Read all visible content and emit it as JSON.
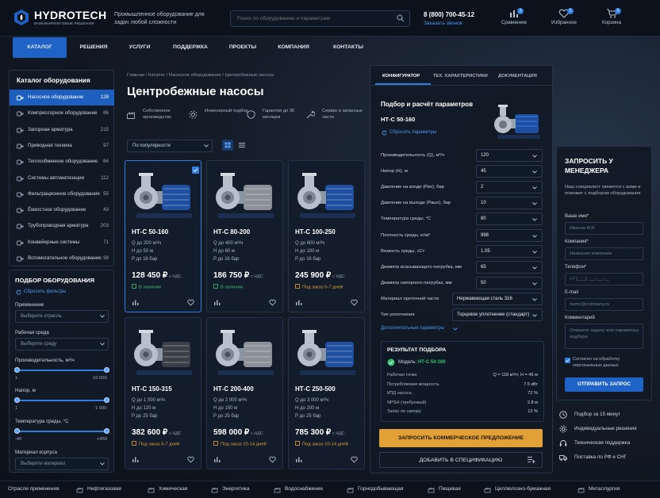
{
  "header": {
    "logo_name": "HYDROTECH",
    "logo_sub": "ИНЖИНИРИНГОВЫЕ РЕШЕНИЯ",
    "tagline": "Промышленное оборудование для задач любой сложности",
    "search_placeholder": "Поиск по оборудованию и параметрам",
    "phone": "8 (800) 700-45-12",
    "callback": "Заказать звонок",
    "actions": [
      {
        "label": "Сравнение",
        "count": "3"
      },
      {
        "label": "Избранное",
        "count": "2"
      },
      {
        "label": "Корзина",
        "count": "0"
      }
    ]
  },
  "nav": [
    "КАТАЛОГ",
    "РЕШЕНИЯ",
    "УСЛУГИ",
    "ПОДДЕРЖКА",
    "ПРОЕКТЫ",
    "КОМПАНИЯ",
    "КОНТАКТЫ"
  ],
  "catalog": {
    "title": "Каталог оборудования",
    "items": [
      {
        "name": "Насосное оборудование",
        "count": "128"
      },
      {
        "name": "Компрессорное оборудование",
        "count": "86"
      },
      {
        "name": "Запорная арматура",
        "count": "215"
      },
      {
        "name": "Приводная техника",
        "count": "97"
      },
      {
        "name": "Теплообменное оборудование",
        "count": "64"
      },
      {
        "name": "Системы автоматизации",
        "count": "112"
      },
      {
        "name": "Фильтрационное оборудование",
        "count": "55"
      },
      {
        "name": "Ёмкостное оборудование",
        "count": "43"
      },
      {
        "name": "Трубопроводная арматура",
        "count": "203"
      },
      {
        "name": "Конвейерные системы",
        "count": "71"
      },
      {
        "name": "Вспомогательное оборудование",
        "count": "98"
      }
    ]
  },
  "filters": {
    "title": "ПОДБОР ОБОРУДОВАНИЯ",
    "reset": "Сбросить фильтры",
    "application_label": "Применение",
    "application_placeholder": "Выберите отрасль",
    "medium_label": "Рабочая среда",
    "medium_placeholder": "Выберите среду",
    "flow_label": "Производительность, м³/ч",
    "flow_min": "1",
    "flow_max": "10 000",
    "head_label": "Напор, м",
    "head_min": "1",
    "head_max": "1 000",
    "temp_label": "Температура среды, °С",
    "temp_min": "-40",
    "temp_max": "+450",
    "material_label": "Материал корпуса",
    "material_placeholder": "Выберите материал"
  },
  "main": {
    "breadcrumb": "Главная  /  Каталог  /  Насосное оборудование  /  Центробежные насосы",
    "title": "Центробежные насосы",
    "features": [
      "Собственное производство",
      "Инженерный подбор",
      "Гарантия до 36 месяцев",
      "Сервис и запасные части"
    ],
    "sort": "По популярности"
  },
  "products": [
    {
      "name": "НТ-С 50-160",
      "q": "Q до 200 м³/ч",
      "h": "Н до 50 м",
      "p": "P до 16 бар",
      "price": "128 450 ₽",
      "vat": "с НДС",
      "stock": "В наличии",
      "stock_color": "#39c172",
      "selected": true,
      "motor": "#1f4fa0"
    },
    {
      "name": "НТ-С 80-200",
      "q": "Q до 400 м³/ч",
      "h": "Н до 80 м",
      "p": "P до 16 бар",
      "price": "186 750 ₽",
      "vat": "с НДС",
      "stock": "В наличии",
      "stock_color": "#39c172",
      "selected": false,
      "motor": "#8b9099"
    },
    {
      "name": "НТ-С 100-250",
      "q": "Q до 600 м³/ч",
      "h": "Н до 100 м",
      "p": "P до 16 бар",
      "price": "245 900 ₽",
      "vat": "с НДС",
      "stock": "Под заказ 5-7 дней",
      "stock_color": "#e2a136",
      "selected": false,
      "motor": "#1f4fa0"
    },
    {
      "name": "НТ-С 150-315",
      "q": "Q до 1 000 м³/ч",
      "h": "Н до 120 м",
      "p": "P до 25 бар",
      "price": "382 600 ₽",
      "vat": "с НДС",
      "stock": "Под заказ 5-7 дней",
      "stock_color": "#e2a136",
      "selected": false,
      "motor": "#3a3f47"
    },
    {
      "name": "НТ-С 200-400",
      "q": "Q до 2 000 м³/ч",
      "h": "Н до 150 м",
      "p": "P до 25 бар",
      "price": "598 000 ₽",
      "vat": "с НДС",
      "stock": "Под заказ 10-14 дней",
      "stock_color": "#e2a136",
      "selected": false,
      "motor": "#8b9099"
    },
    {
      "name": "НТ-С 250-500",
      "q": "Q до 3 000 м³/ч",
      "h": "Н до 200 м",
      "p": "P до 25 бар",
      "price": "785 300 ₽",
      "vat": "с НДС",
      "stock": "Под заказ 10-14 дней",
      "stock_color": "#e2a136",
      "selected": false,
      "motor": "#1f4fa0"
    }
  ],
  "config": {
    "tabs": [
      "КОНФИГУРАТОР",
      "ТЕХ. ХАРАКТЕРИСТИКИ",
      "ДОКУМЕНТАЦИЯ"
    ],
    "title": "Подбор и расчёт параметров",
    "model": "НТ-С 50-160",
    "reset": "Сбросить параметры",
    "params": [
      {
        "label": "Производительность (Q), м³/ч",
        "value": "120"
      },
      {
        "label": "Напор (Н), м",
        "value": "45"
      },
      {
        "label": "Давление на входе (Pвх), бар",
        "value": "2"
      },
      {
        "label": "Давление на выходе (Pвых), бар",
        "value": "10"
      },
      {
        "label": "Температура среды, °С",
        "value": "80"
      },
      {
        "label": "Плотность среды, кг/м³",
        "value": "998"
      },
      {
        "label": "Вязкость среды, сСт",
        "value": "1.05"
      },
      {
        "label": "Диаметр всасывающего патрубка, мм",
        "value": "65"
      },
      {
        "label": "Диаметр напорного патрубка, мм",
        "value": "50"
      },
      {
        "label": "Материал проточной части",
        "value": "Нержавеющая сталь 316"
      },
      {
        "label": "Тип уплотнения",
        "value": "Торцевое уплотнение (стандарт)"
      }
    ],
    "more": "Дополнительные параметры",
    "result_title": "РЕЗУЛЬТАТ ПОДБОРА",
    "result_model_label": "Модель:",
    "result_model": "НТ-С 50-160",
    "result_rows": [
      {
        "label": "Рабочая точка",
        "value": "Q = 118 м³/ч; Н = 46 м"
      },
      {
        "label": "Потребляемая мощность",
        "value": "7.5 кВт"
      },
      {
        "label": "КПД насоса",
        "value": "72 %"
      },
      {
        "label": "NPSH (требуемый)",
        "value": "2.8 м"
      },
      {
        "label": "Запас по напору",
        "value": "12 %"
      }
    ],
    "offer_btn": "ЗАПРОСИТЬ КОММЕРЧЕСКОЕ ПРЕДЛОЖЕНИЕ",
    "spec_btn": "ДОБАВИТЬ В СПЕЦИФИКАЦИЮ"
  },
  "request": {
    "title": "ЗАПРОСИТЬ У МЕНЕДЖЕРА",
    "subtitle": "Наш специалист свяжется с вами и поможет с подбором оборудования",
    "name_label": "Ваше имя*",
    "name_placeholder": "Иванов И.И.",
    "company_label": "Компания*",
    "company_placeholder": "Название компании",
    "phone_label": "Телефон*",
    "phone_placeholder": "+7 (___) ___-__-__",
    "email_label": "E-mail",
    "email_placeholder": "name@company.ru",
    "comment_label": "Комментарий",
    "comment_placeholder": "Опишите задачу или параметры подбора",
    "consent": "Согласен на обработку персональных данных",
    "button": "ОТПРАВИТЬ ЗАПРОС"
  },
  "benefits": [
    "Подбор за 15 минут",
    "Индивидуальные решения",
    "Техническая поддержка",
    "Поставка по РФ и СНГ"
  ],
  "footer": {
    "lead": "Отрасли применения",
    "industries": [
      "Нефтегазовая",
      "Химическая",
      "Энергетика",
      "Водоснабжение",
      "Горнодобывающая",
      "Пищевая",
      "Целлюлозно-бумажная",
      "Металлургия"
    ]
  },
  "colors": {
    "accent": "#1e63c5",
    "link": "#4d96ee",
    "cta": "#e2a136",
    "ok": "#39c172",
    "bg": "#0b111a"
  }
}
